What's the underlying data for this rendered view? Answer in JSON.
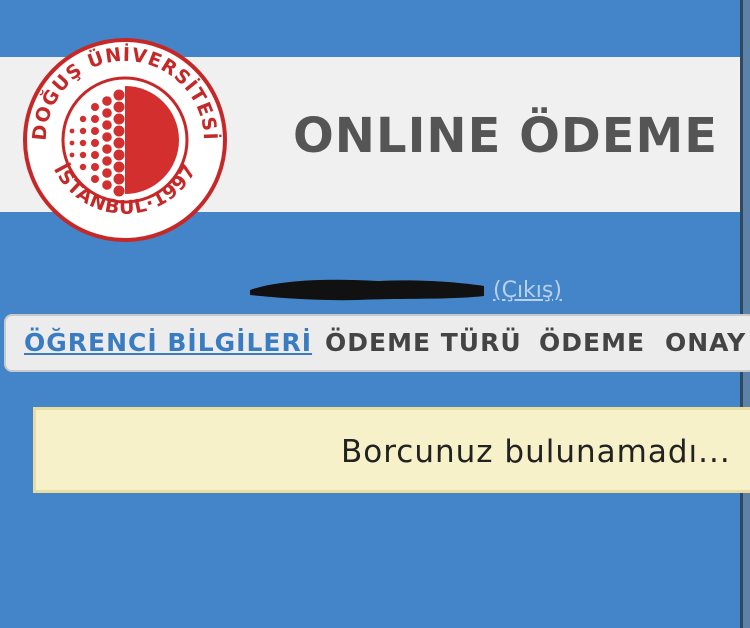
{
  "header": {
    "title": "ONLINE ÖDEME",
    "logo": {
      "top_text": "DOĞUŞ ÜNİVERSİTESİ",
      "bottom_text": "İSTANBUL·1997",
      "colors": {
        "ring": "#c62828",
        "fill": "#d32f2f"
      }
    }
  },
  "user": {
    "logout_label": "(Çıkış)"
  },
  "nav": {
    "items": [
      {
        "label": "ÖĞRENCİ BİLGİLERİ",
        "active": true
      },
      {
        "label": "ÖDEME TÜRÜ",
        "active": false
      },
      {
        "label": "ÖDEME",
        "active": false
      },
      {
        "label": "ONAY",
        "active": false
      }
    ]
  },
  "alert": {
    "message": "Borcunuz bulunamadı..."
  },
  "colors": {
    "page_background": "#4485c9",
    "header_band": "#f0f0f0",
    "nav_active": "#3a7cc1",
    "alert_background": "#f6f1c8"
  }
}
